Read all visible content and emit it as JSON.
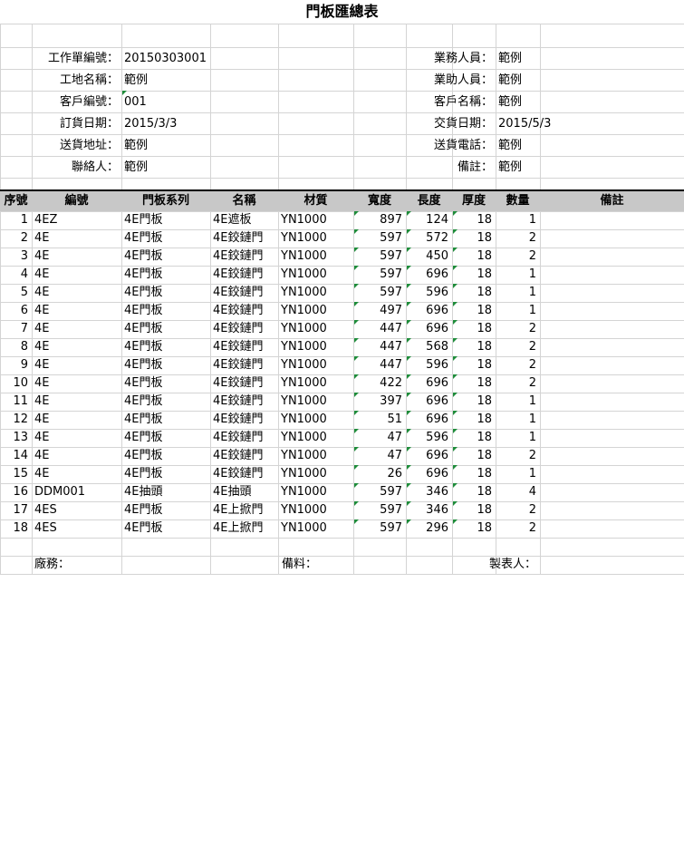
{
  "title": "門板匯總表",
  "info_left": [
    {
      "label": "工作單編號：",
      "value": "20150303001"
    },
    {
      "label": "工地名稱：",
      "value": "範例"
    },
    {
      "label": "客戶編號：",
      "value": "001"
    },
    {
      "label": "訂貨日期：",
      "value": "2015/3/3"
    },
    {
      "label": "送貨地址：",
      "value": "範例"
    },
    {
      "label": "聯絡人：",
      "value": "範例"
    }
  ],
  "info_right": [
    {
      "label": "業務人員：",
      "value": "範例"
    },
    {
      "label": "業助人員：",
      "value": "範例"
    },
    {
      "label": "客戶名稱：",
      "value": "範例"
    },
    {
      "label": "交貨日期：",
      "value": "2015/5/3"
    },
    {
      "label": "送貨電話：",
      "value": "範例"
    },
    {
      "label": "備註：",
      "value": "範例"
    }
  ],
  "table": {
    "headers": [
      "序號",
      "編號",
      "門板系列",
      "名稱",
      "材質",
      "寬度",
      "長度",
      "厚度",
      "數量",
      "備註"
    ],
    "rows": [
      [
        "1",
        "4EZ",
        "4E門板",
        "4E遮板",
        "YN1000",
        "897",
        "124",
        "18",
        "1",
        ""
      ],
      [
        "2",
        "4E",
        "4E門板",
        "4E鉸鏈門",
        "YN1000",
        "597",
        "572",
        "18",
        "2",
        ""
      ],
      [
        "3",
        "4E",
        "4E門板",
        "4E鉸鏈門",
        "YN1000",
        "597",
        "450",
        "18",
        "2",
        ""
      ],
      [
        "4",
        "4E",
        "4E門板",
        "4E鉸鏈門",
        "YN1000",
        "597",
        "696",
        "18",
        "1",
        ""
      ],
      [
        "5",
        "4E",
        "4E門板",
        "4E鉸鏈門",
        "YN1000",
        "597",
        "596",
        "18",
        "1",
        ""
      ],
      [
        "6",
        "4E",
        "4E門板",
        "4E鉸鏈門",
        "YN1000",
        "497",
        "696",
        "18",
        "1",
        ""
      ],
      [
        "7",
        "4E",
        "4E門板",
        "4E鉸鏈門",
        "YN1000",
        "447",
        "696",
        "18",
        "2",
        ""
      ],
      [
        "8",
        "4E",
        "4E門板",
        "4E鉸鏈門",
        "YN1000",
        "447",
        "568",
        "18",
        "2",
        ""
      ],
      [
        "9",
        "4E",
        "4E門板",
        "4E鉸鏈門",
        "YN1000",
        "447",
        "596",
        "18",
        "2",
        ""
      ],
      [
        "10",
        "4E",
        "4E門板",
        "4E鉸鏈門",
        "YN1000",
        "422",
        "696",
        "18",
        "2",
        ""
      ],
      [
        "11",
        "4E",
        "4E門板",
        "4E鉸鏈門",
        "YN1000",
        "397",
        "696",
        "18",
        "1",
        ""
      ],
      [
        "12",
        "4E",
        "4E門板",
        "4E鉸鏈門",
        "YN1000",
        "51",
        "696",
        "18",
        "1",
        ""
      ],
      [
        "13",
        "4E",
        "4E門板",
        "4E鉸鏈門",
        "YN1000",
        "47",
        "596",
        "18",
        "1",
        ""
      ],
      [
        "14",
        "4E",
        "4E門板",
        "4E鉸鏈門",
        "YN1000",
        "47",
        "696",
        "18",
        "2",
        ""
      ],
      [
        "15",
        "4E",
        "4E門板",
        "4E鉸鏈門",
        "YN1000",
        "26",
        "696",
        "18",
        "1",
        ""
      ],
      [
        "16",
        "DDM001",
        "4E抽頭",
        "4E抽頭",
        "YN1000",
        "597",
        "346",
        "18",
        "4",
        ""
      ],
      [
        "17",
        "4ES",
        "4E門板",
        "4E上掀門",
        "YN1000",
        "597",
        "346",
        "18",
        "2",
        ""
      ],
      [
        "18",
        "4ES",
        "4E門板",
        "4E上掀門",
        "YN1000",
        "597",
        "296",
        "18",
        "2",
        ""
      ]
    ]
  },
  "footer": {
    "factory": "廠務：",
    "material": "備料：",
    "preparer": "製表人："
  },
  "colors": {
    "grid": "#d4d4d4",
    "header_fill": "#c8c8c8",
    "cell_marker": "#1e8c3a"
  }
}
